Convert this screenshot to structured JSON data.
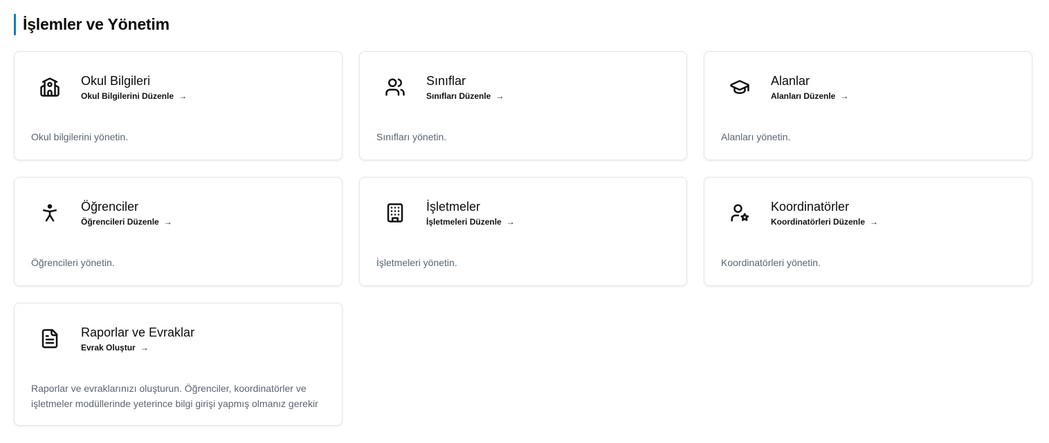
{
  "section": {
    "title": "İşlemler ve Yönetim"
  },
  "cards": [
    {
      "title": "Okul Bilgileri",
      "link": "Okul Bilgilerini Düzenle",
      "description": "Okul bilgilerini yönetin.",
      "icon": "school-icon"
    },
    {
      "title": "Sınıflar",
      "link": "Sınıfları Düzenle",
      "description": "Sınıfları yönetin.",
      "icon": "users-icon"
    },
    {
      "title": "Alanlar",
      "link": "Alanları Düzenle",
      "description": "Alanları yönetin.",
      "icon": "graduation-cap-icon"
    },
    {
      "title": "Öğrenciler",
      "link": "Öğrencileri Düzenle",
      "description": "Öğrencileri yönetin.",
      "icon": "accessibility-icon"
    },
    {
      "title": "İşletmeler",
      "link": "İşletmeleri Düzenle",
      "description": "İşletmeleri yönetin.",
      "icon": "building-icon"
    },
    {
      "title": "Koordinatörler",
      "link": "Koordinatörleri Düzenle",
      "description": "Koordinatörleri yönetin.",
      "icon": "user-star-icon"
    },
    {
      "title": "Raporlar ve Evraklar",
      "link": "Evrak Oluştur",
      "description": "Raporlar ve evraklarınızı oluşturun. Öğrenciler, koordinatörler ve işletmeler modüllerinde yeterince bilgi girişi yapmış olmanız gerekir",
      "icon": "file-text-icon"
    }
  ],
  "colors": {
    "accent": "#0c7dc2",
    "card_border": "#e3e5e8",
    "description_text": "#5b6470"
  }
}
